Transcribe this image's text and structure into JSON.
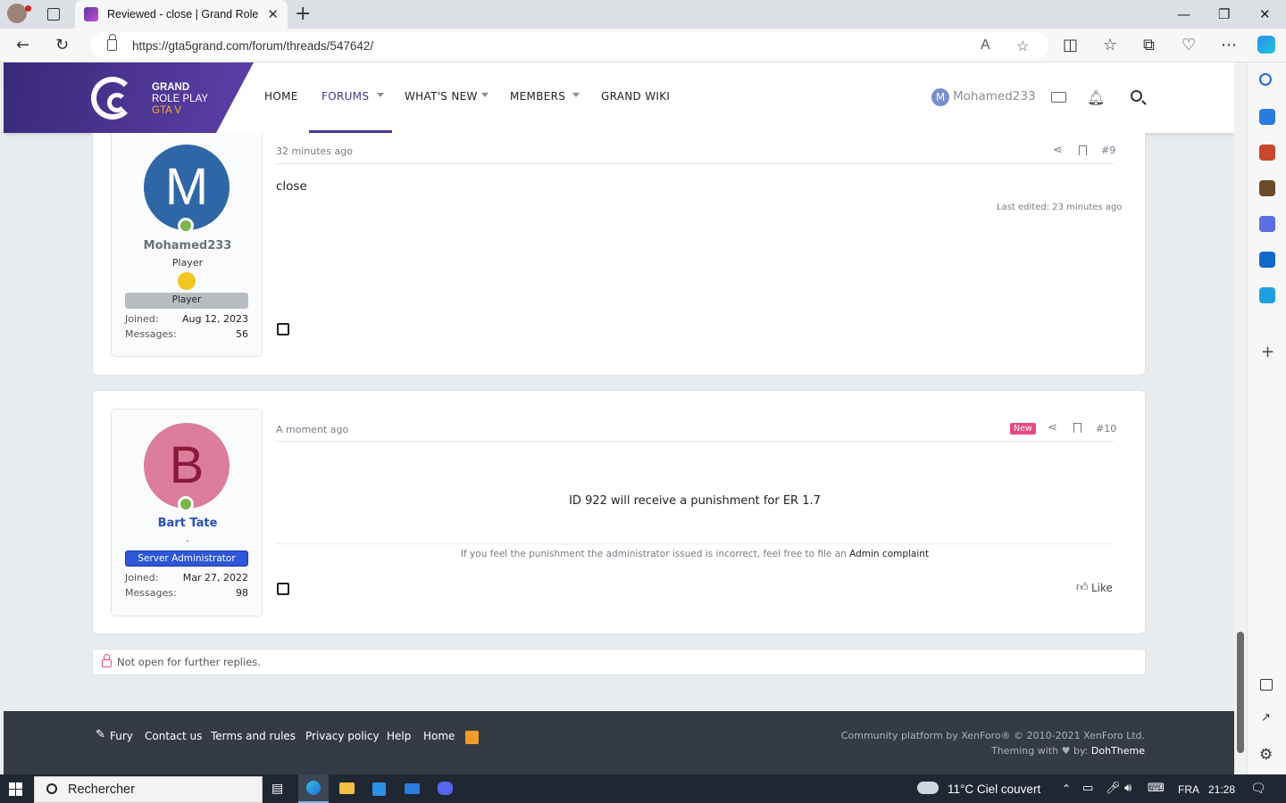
{
  "browser": {
    "tab_title": "Reviewed - close | Grand Role Pla",
    "url": "https://gta5grand.com/forum/threads/547642/"
  },
  "forum": {
    "logo": {
      "line1": "GRAND",
      "line2": "ROLE PLAY",
      "line3": "GTA V"
    },
    "nav": [
      "HOME",
      "FORUMS",
      "WHAT'S NEW",
      "MEMBERS",
      "GRAND WIKI"
    ],
    "active_nav": "FORUMS",
    "user_initial": "M",
    "username": "Mohamed233"
  },
  "posts": [
    {
      "initial": "M",
      "avatar_color": "#2f67a6",
      "author": "Mohamed233",
      "author_color": "#6b707a",
      "user_title": "Player",
      "banner": "Player",
      "banner_color": "#b9bcc1",
      "joined_label": "Joined:",
      "joined": "Aug 12, 2023",
      "messages_label": "Messages:",
      "messages": "56",
      "time": "32 minutes ago",
      "number": "#9",
      "body": "close",
      "edited": "Last edited: 23 minutes ago"
    },
    {
      "initial": "B",
      "avatar_color": "#dc7d9d",
      "author": "Bart Tate",
      "author_color": "#2b4fb6",
      "user_title": ".",
      "banner": "Server Administrator",
      "banner_color": "#2d56d8",
      "joined_label": "Joined:",
      "joined": "Mar 27, 2022",
      "messages_label": "Messages:",
      "messages": "98",
      "time": "A moment ago",
      "badge": "New",
      "number": "#10",
      "body": "ID 922 will receive a punishment for ER 1.7",
      "note": "If you feel the punishment the administrator issued is incorrect, feel free to file an",
      "note_link": "Admin complaint",
      "like": "Like"
    }
  ],
  "locked_text": "Not open for further replies.",
  "footer": {
    "links": [
      "Fury",
      "Contact us",
      "Terms and rules",
      "Privacy policy",
      "Help",
      "Home"
    ],
    "copyright": "Community platform by XenForo® © 2010-2021 XenForo Ltd.",
    "theme_prefix": "Theming with",
    "theme_by": "by:",
    "theme_name": "DohTheme"
  },
  "taskbar": {
    "search": "Rechercher",
    "weather": "11°C  Ciel couvert",
    "lang": "FRA",
    "time": "21:28"
  },
  "colors": {
    "brand": "#4a3a9a",
    "accent_gold": "#f0b429",
    "footer": "#353b45"
  }
}
